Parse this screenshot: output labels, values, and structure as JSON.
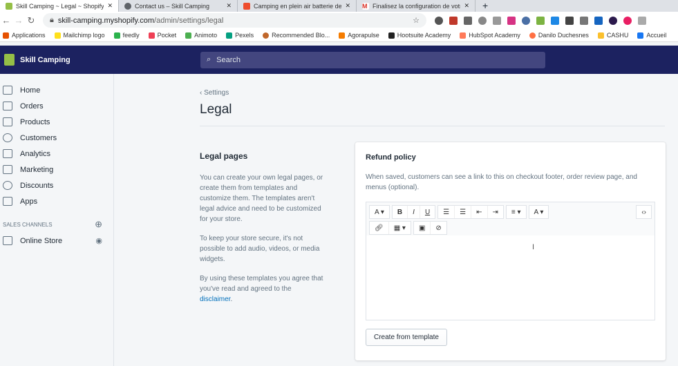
{
  "browser": {
    "tabs": [
      {
        "title": "Skill Camping ~ Legal ~ Shopify",
        "active": true,
        "color": "#95bf47"
      },
      {
        "title": "Contact us – Skill Camping",
        "active": false,
        "color": "#5f6368"
      },
      {
        "title": "Camping en plein air batterie de",
        "active": false,
        "color": "#ee4d2d"
      },
      {
        "title": "Finalisez la configuration de votre",
        "active": false,
        "color": "#d93025"
      }
    ],
    "new_tab": "+",
    "close": "✕",
    "url_host": "skill-camping.myshopify.com",
    "url_path": "/admin/settings/legal",
    "bookmarks": [
      "Applications",
      "Mailchimp logo",
      "feedly",
      "Pocket",
      "Animoto",
      "Pexels",
      "Recommended Blo...",
      "Agorapulse",
      "Hootsuite Academy",
      "HubSpot Academy",
      "Danilo Duchesnes",
      "CASHU",
      "Accueil"
    ]
  },
  "topbar": {
    "store": "Skill Camping",
    "search_placeholder": "Search"
  },
  "sidebar": {
    "items": [
      {
        "label": "Home"
      },
      {
        "label": "Orders"
      },
      {
        "label": "Products"
      },
      {
        "label": "Customers"
      },
      {
        "label": "Analytics"
      },
      {
        "label": "Marketing"
      },
      {
        "label": "Discounts"
      },
      {
        "label": "Apps"
      }
    ],
    "channels_heading": "SALES CHANNELS",
    "online_store": "Online Store"
  },
  "page": {
    "breadcrumb": "Settings",
    "title": "Legal",
    "annotation": {
      "heading": "Legal pages",
      "p1": "You can create your own legal pages, or create them from templates and customize them. The templates aren't legal advice and need to be customized for your store.",
      "p2": "To keep your store secure, it's not possible to add audio, videos, or media widgets.",
      "p3": "By using these templates you agree that you've read and agreed to the",
      "link": "disclaimer",
      "p3_end": "."
    },
    "card": {
      "title": "Refund policy",
      "help": "When saved, customers can see a link to this on checkout footer, order review page, and menus (optional).",
      "create_button": "Create from template"
    }
  }
}
